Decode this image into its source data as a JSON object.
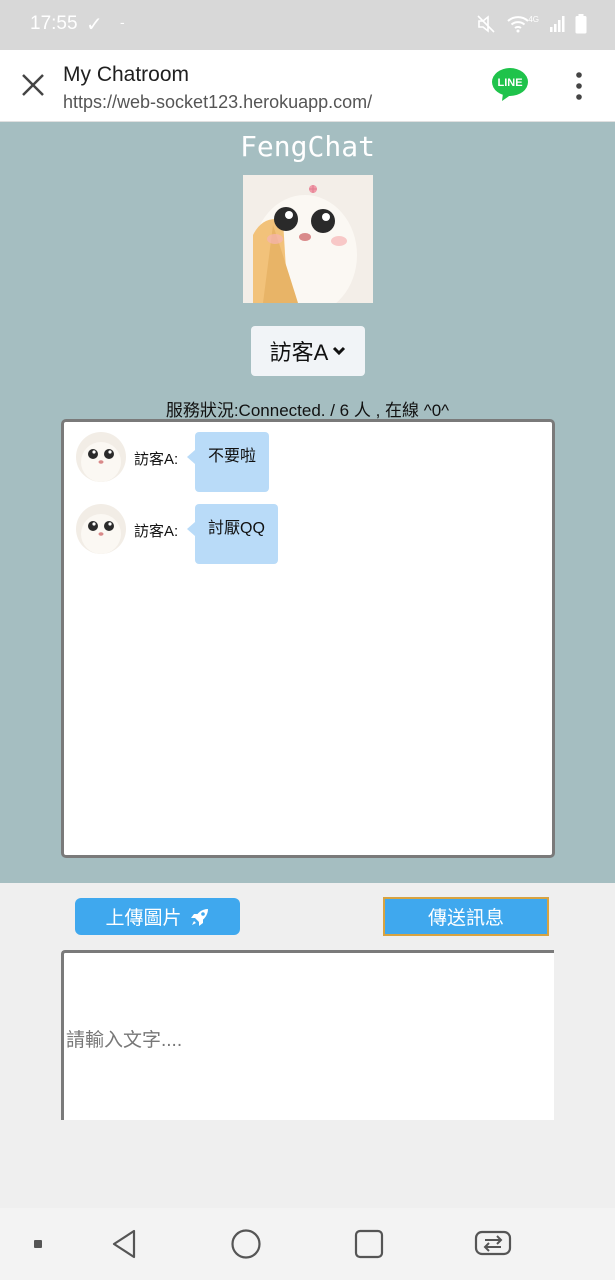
{
  "status_bar": {
    "time": "17:55",
    "check_icon": "check-icon",
    "dash": "-",
    "icons": [
      "mute-icon",
      "wifi-icon",
      "signal-icon",
      "battery-icon"
    ],
    "network_label": "4G"
  },
  "browser": {
    "close_icon": "close-icon",
    "title": "My Chatroom",
    "url": "https://web-socket123.herokuapp.com/",
    "line_label": "LINE",
    "menu_icon": "more-vert-icon"
  },
  "app": {
    "title": "FengChat",
    "user_select": {
      "selected": "訪客A",
      "icon": "chevron-down-icon"
    },
    "service_status": "服務狀況:Connected. / 6 人 , 在線 ^0^"
  },
  "chat": {
    "messages": [
      {
        "sender": "訪客A:",
        "text": "不要啦"
      },
      {
        "sender": "訪客A:",
        "text": "討厭QQ"
      }
    ]
  },
  "controls": {
    "upload_label": "上傳圖片",
    "upload_icon": "rocket-icon",
    "send_label": "傳送訊息",
    "input_placeholder": "請輸入文字...."
  },
  "nav": [
    "back-icon",
    "home-icon",
    "recents-icon",
    "rotate-icon"
  ],
  "colors": {
    "main_bg": "#a5bec1",
    "button_blue": "#3fa8ee",
    "bubble": "#b9dbf8",
    "send_border": "#d7a341",
    "line_green": "#1fc34b"
  }
}
